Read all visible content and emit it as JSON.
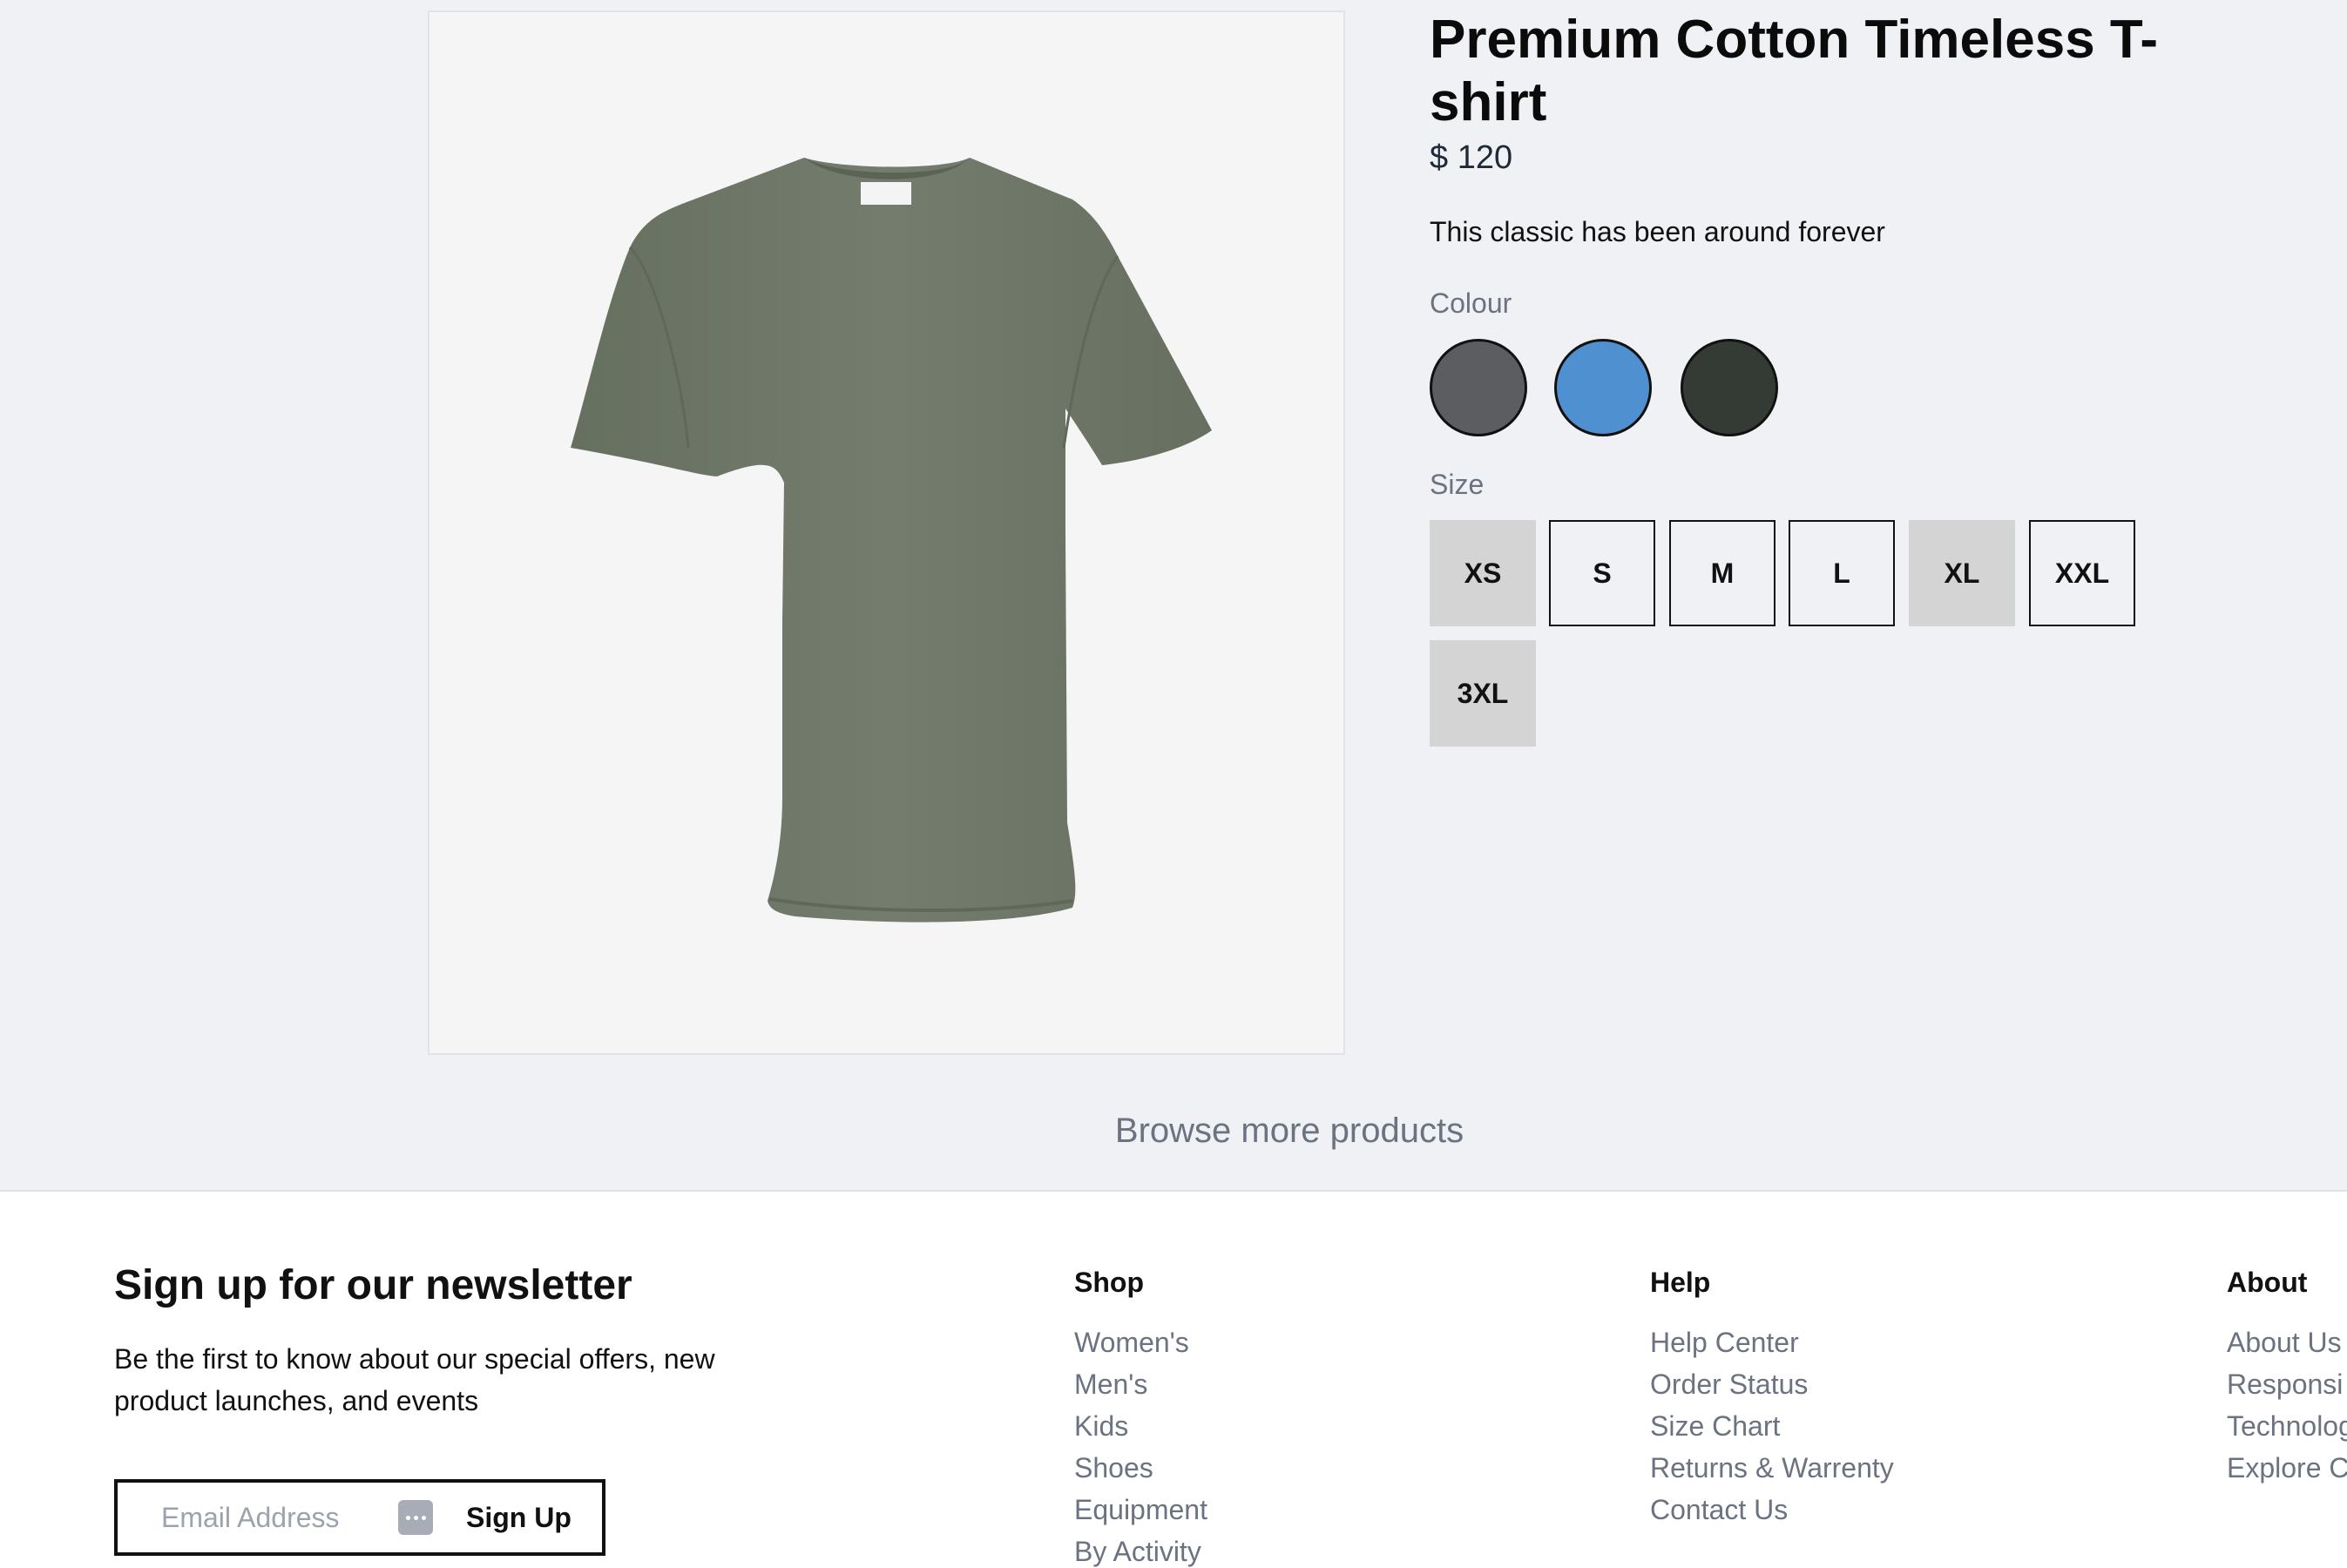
{
  "product": {
    "title": "Premium Cotton Timeless T-shirt",
    "price": "$ 120",
    "description": "This classic has been around forever",
    "colour_label": "Colour",
    "colours": [
      "#5b5d61",
      "#4f90d0",
      "#343a34"
    ],
    "size_label": "Size",
    "sizes": [
      {
        "label": "XS",
        "available": false
      },
      {
        "label": "S",
        "available": true
      },
      {
        "label": "M",
        "available": true
      },
      {
        "label": "L",
        "available": true
      },
      {
        "label": "XL",
        "available": false
      },
      {
        "label": "XXL",
        "available": true
      },
      {
        "label": "3XL",
        "available": false
      }
    ],
    "image_icon": "olive-tshirt-image"
  },
  "browse_label": "Browse more products",
  "footer": {
    "newsletter_title": "Sign up for our newsletter",
    "newsletter_text": "Be the first to know about our special offers, new product launches, and events",
    "email_placeholder": "Email Address",
    "signup_label": "Sign Up",
    "columns": [
      {
        "title": "Shop",
        "links": [
          "Women's",
          "Men's",
          "Kids",
          "Shoes",
          "Equipment",
          "By Activity"
        ]
      },
      {
        "title": "Help",
        "links": [
          "Help Center",
          "Order Status",
          "Size Chart",
          "Returns & Warrenty",
          "Contact Us"
        ]
      },
      {
        "title": "About",
        "links": [
          "About Us",
          "Responsi",
          "Technolog",
          "Explore C"
        ]
      }
    ]
  }
}
